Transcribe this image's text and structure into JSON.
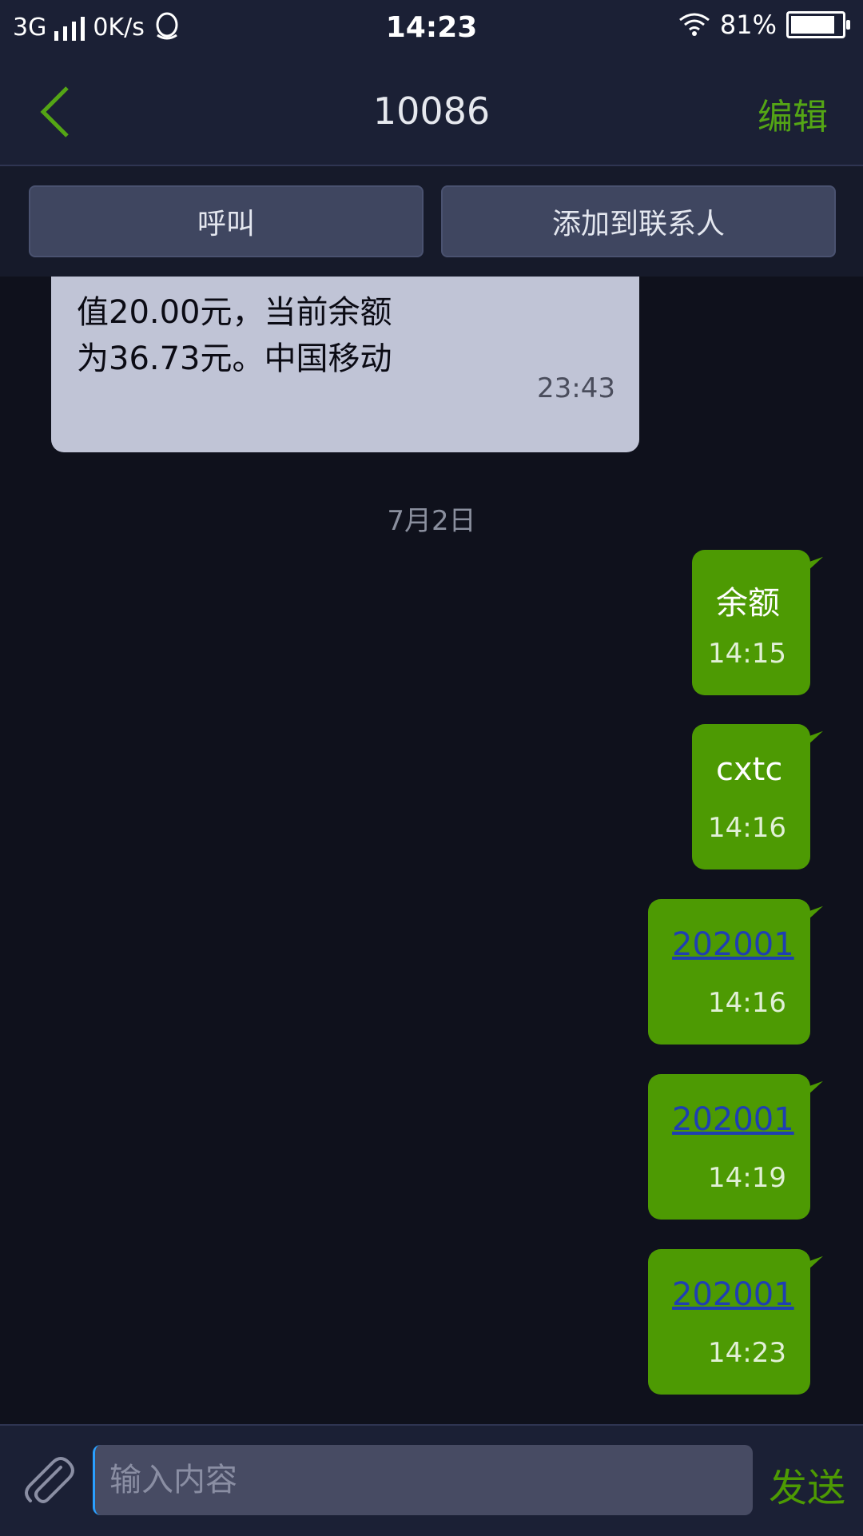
{
  "status_bar": {
    "network": "3G",
    "speed": "0K/s",
    "time": "14:23",
    "battery": "81%"
  },
  "header": {
    "title": "10086",
    "edit_label": "编辑"
  },
  "actions": {
    "call_label": "呼叫",
    "add_contact_label": "添加到联系人"
  },
  "incoming": {
    "line1": "值20.00元，当前余额",
    "line2": "为36.73元。中国移动",
    "time": "23:43"
  },
  "date_separator": "7月2日",
  "outgoing": [
    {
      "text": "余额",
      "time": "14:15"
    },
    {
      "text": "cxtc",
      "time": "14:16"
    },
    {
      "text": "202001",
      "time": "14:16"
    },
    {
      "text": "202001",
      "time": "14:19"
    },
    {
      "text": "202001",
      "time": "14:23"
    }
  ],
  "composer": {
    "placeholder": "输入内容",
    "send_label": "发送"
  },
  "colors": {
    "bubble_out": "#4d9a03",
    "bubble_in": "#c0c4d6",
    "accent": "#54a515",
    "link": "#1f3fb2"
  }
}
